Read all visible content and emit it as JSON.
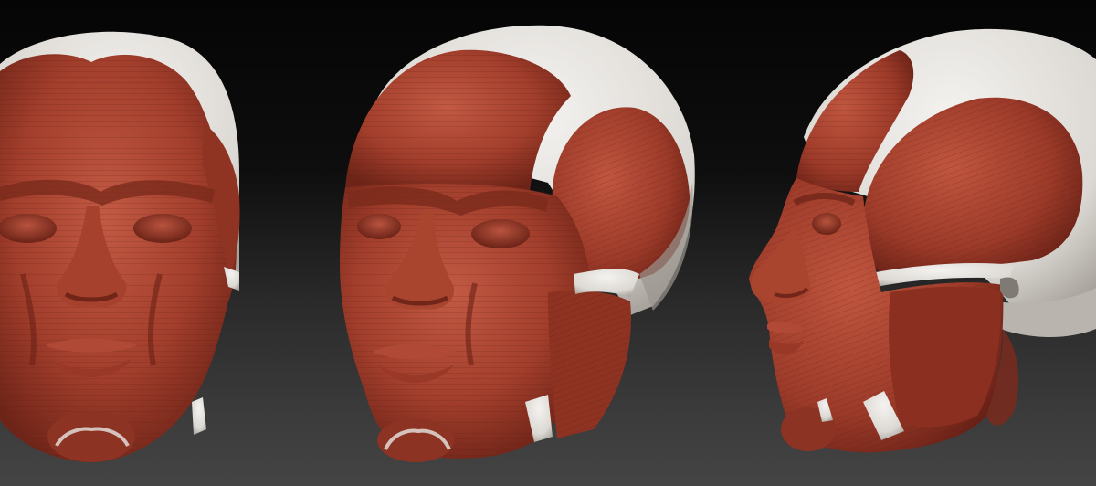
{
  "scene": {
    "subject": "ecorche-head-sculpt-views",
    "views": [
      {
        "id": "front-view"
      },
      {
        "id": "three-quarter-view"
      },
      {
        "id": "side-profile-view"
      }
    ]
  },
  "colors": {
    "background_top": "#050505",
    "background_bottom": "#444444",
    "muscle": "#a23e2c",
    "muscle_shadow": "#6e2418",
    "muscle_highlight": "#c6604a",
    "tendon": "#e8e6e2",
    "tendon_shadow": "#b8b4ae"
  }
}
